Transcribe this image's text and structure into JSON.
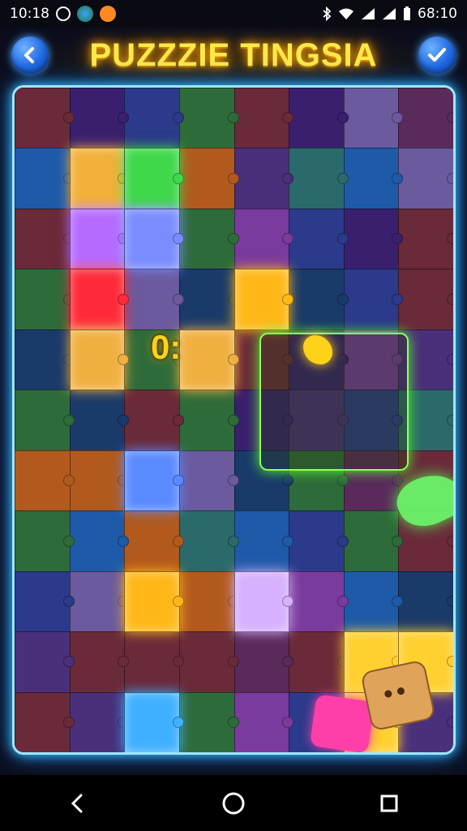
{
  "status_bar": {
    "time": "10:18",
    "clock_right": "68:10",
    "icons": [
      "whatsapp-icon",
      "globe-icon",
      "orange-app-icon",
      "bluetooth-icon",
      "wifi-icon",
      "signal-icon",
      "battery-icon"
    ]
  },
  "header": {
    "title": "PUZZZIE TINGSIA",
    "back_icon": "back-arrow-icon",
    "confirm_icon": "checkmark-icon"
  },
  "game": {
    "counter": "0:",
    "colors": {
      "board_border": "#9fe6ff",
      "title": "#ffe94a",
      "highlight_frame": "#8cff5a",
      "button": "#1f67e0"
    },
    "palette": [
      "#6b5a9e",
      "#2b3a8a",
      "#2e6b3a",
      "#4a2f7a",
      "#b25a1e",
      "#6a2a3a",
      "#3a1f6e",
      "#1e5aa8",
      "#7a3a9e",
      "#2a6a6a",
      "#5a2a5a",
      "#1a3a6a"
    ]
  },
  "nav": {
    "back_icon": "nav-back-icon",
    "home_icon": "nav-home-icon",
    "recents_icon": "nav-recents-icon"
  }
}
